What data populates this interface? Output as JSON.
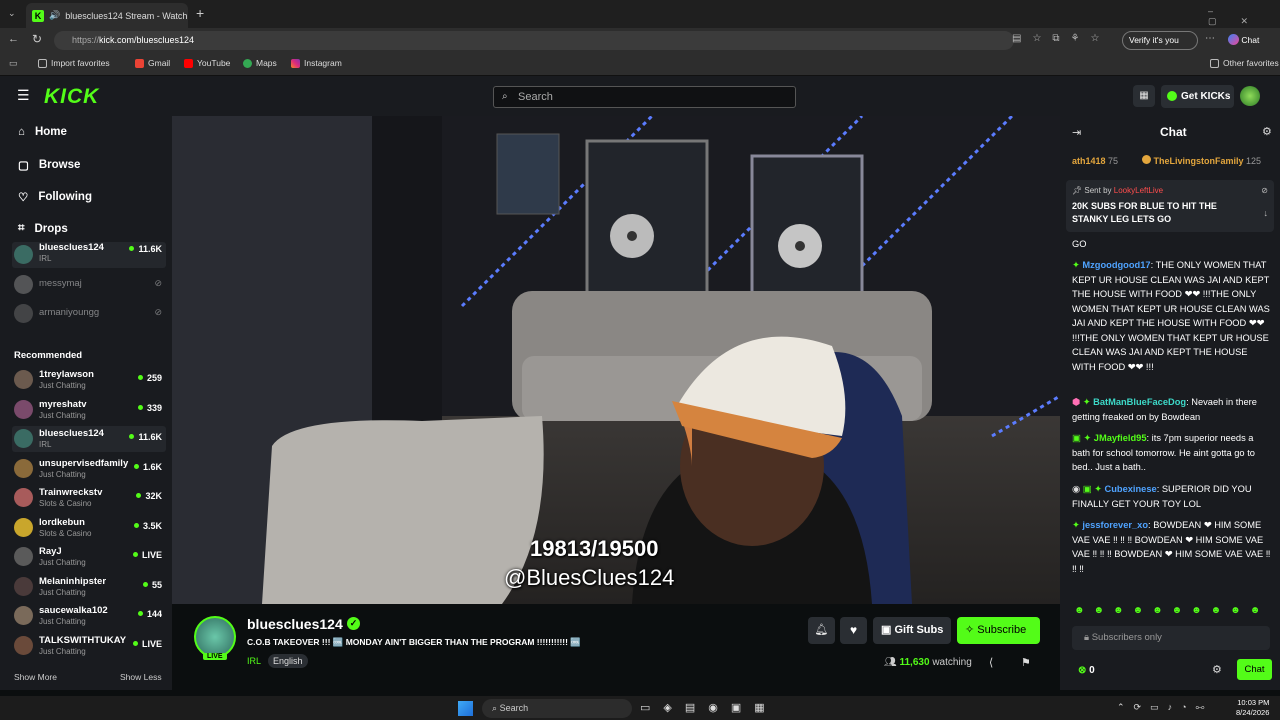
{
  "browser": {
    "tab_title": "bluesclues124 Stream - Watch",
    "url_prefix": "https://",
    "url_main": "kick.com/bluesclues124",
    "verify": "Verify it's you",
    "chat_btn": "Chat",
    "bookmarks": [
      "Import favorites",
      "Gmail",
      "YouTube",
      "Maps",
      "Instagram"
    ],
    "other_favorites": "Other favorites"
  },
  "header": {
    "logo": "KICK",
    "search_placeholder": "Search",
    "get_kicks": "Get KICKs"
  },
  "sidebar": {
    "nav": [
      "Home",
      "Browse",
      "Following",
      "Drops"
    ],
    "following": [
      {
        "name": "bluesclues124",
        "cat": "IRL",
        "viewers": "11.6K"
      },
      {
        "name": "messymaj",
        "cat": "",
        "viewers": ""
      },
      {
        "name": "armaniyoungg",
        "cat": "",
        "viewers": ""
      }
    ],
    "recommended_label": "Recommended",
    "recommended": [
      {
        "name": "1treylawson",
        "cat": "Just Chatting",
        "viewers": "259"
      },
      {
        "name": "myreshatv",
        "cat": "Just Chatting",
        "viewers": "339"
      },
      {
        "name": "bluesclues124",
        "cat": "IRL",
        "viewers": "11.6K"
      },
      {
        "name": "unsupervisedfamily",
        "cat": "Just Chatting",
        "viewers": "1.6K"
      },
      {
        "name": "Trainwreckstv",
        "cat": "Slots & Casino",
        "viewers": "32K"
      },
      {
        "name": "lordkebun",
        "cat": "Slots & Casino",
        "viewers": "3.5K"
      },
      {
        "name": "RayJ",
        "cat": "Just Chatting",
        "viewers": "LIVE"
      },
      {
        "name": "Melaninhipster",
        "cat": "Just Chatting",
        "viewers": "55"
      },
      {
        "name": "saucewalka102",
        "cat": "Just Chatting",
        "viewers": "144"
      },
      {
        "name": "TALKSWITHTUKAY",
        "cat": "Just Chatting",
        "viewers": "LIVE"
      }
    ],
    "show_more": "Show More",
    "show_less": "Show Less"
  },
  "video": {
    "counter": "19813/19500",
    "handle": "@BluesClues124"
  },
  "stream": {
    "username": "bluesclues124",
    "live_badge": "LIVE",
    "title": "C.O.B TAKEOVER !!! 🆒 MONDAY AIN'T BIGGER THAN THE PROGRAM !!!!!!!!!!! 🆒",
    "category": "IRL",
    "language": "English",
    "gift_subs": "Gift Subs",
    "subscribe": "Subscribe",
    "watching_count": "11,630",
    "watching_label": "watching"
  },
  "chat": {
    "title": "Chat",
    "top_bar": [
      {
        "user": "ath1418",
        "count": "75"
      },
      {
        "user": "TheLivingstonFamily",
        "count": "125"
      }
    ],
    "pinned_sender_label": "Sent by",
    "pinned_sender": "LookyLeftLive",
    "pinned_text": "20K SUBS FOR BLUE TO HIT THE STANKY LEG LETS GO",
    "pinned_tail": "GO",
    "messages": [
      {
        "user": "Mzgoodgood17",
        "text": "THE ONLY WOMEN THAT KEPT UR HOUSE CLEAN WAS JAI AND KEPT THE HOUSE WITH FOOD ❤❤ !!!THE ONLY WOMEN THAT KEPT UR HOUSE CLEAN WAS JAI AND KEPT THE HOUSE WITH FOOD ❤❤ !!!THE ONLY WOMEN THAT KEPT UR HOUSE CLEAN WAS JAI AND KEPT THE HOUSE WITH FOOD ❤❤ !!!"
      },
      {
        "user": "BatManBlueFaceDog",
        "text": "Nevaeh in there getting freaked on by Bowdean"
      },
      {
        "user": "JMayfield95",
        "text": "its 7pm superior needs a bath for school tomorrow. He aint gotta go to bed.. Just a bath.."
      },
      {
        "user": "Cubexinese",
        "text": "SUPERIOR DID YOU FINALLY GET YOUR TOY LOL"
      },
      {
        "user": "jessforever_xo",
        "text": "BOWDEAN ❤ HIM SOME VAE VAE ‼ ‼ ‼ BOWDEAN ❤ HIM SOME VAE VAE ‼ ‼ ‼ BOWDEAN ❤ HIM SOME VAE VAE ‼ ‼ ‼"
      }
    ],
    "input_placeholder": "Subscribers only",
    "kicks_count": "0",
    "send": "Chat"
  },
  "taskbar": {
    "search": "Search",
    "time": "10:03 PM",
    "date": "8/24/2026"
  },
  "colors": {
    "kick_green": "#53fc18",
    "bg": "#0b0e0f",
    "panel": "#191b1f"
  }
}
